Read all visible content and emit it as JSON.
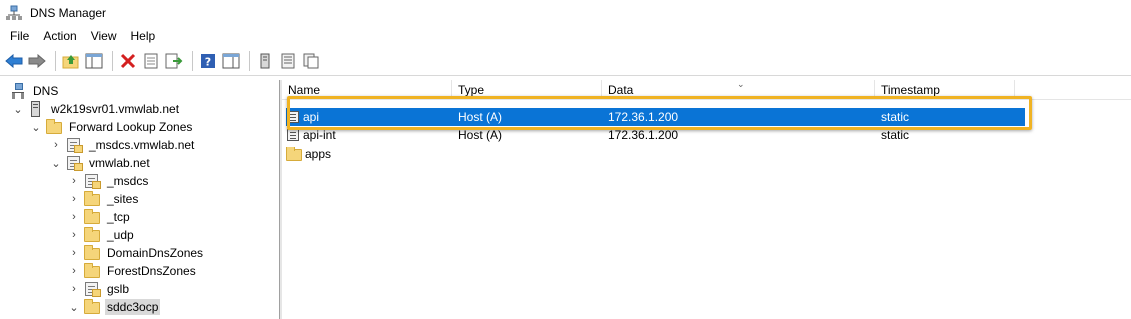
{
  "window": {
    "title": "DNS Manager",
    "icon": "dns-manager-icon"
  },
  "menu": [
    {
      "label": "File"
    },
    {
      "label": "Action"
    },
    {
      "label": "View"
    },
    {
      "label": "Help"
    }
  ],
  "toolbar": {
    "buttons": [
      "back-icon",
      "forward-icon",
      "up-folder-icon",
      "show-hide-console-tree-icon",
      "delete-icon",
      "properties-icon",
      "export-list-icon",
      "help-icon",
      "show-hide-action-pane-icon",
      "server-icon",
      "zone-list-icon",
      "copy-icon"
    ]
  },
  "tree": {
    "root": "DNS",
    "server": "w2k19svr01.vmwlab.net",
    "forward_zones": "Forward Lookup Zones",
    "zones": [
      "_msdcs.vmwlab.net",
      "vmwlab.net"
    ],
    "children": [
      "_msdcs",
      "_sites",
      "_tcp",
      "_udp",
      "DomainDnsZones",
      "ForestDnsZones",
      "gslb",
      "sddc3ocp"
    ],
    "selected": "sddc3ocp"
  },
  "list": {
    "columns": [
      "Name",
      "Type",
      "Data",
      "Timestamp"
    ],
    "rows": [
      {
        "name": "api",
        "type": "Host (A)",
        "data": "172.36.1.200",
        "timestamp": "static"
      },
      {
        "name": "api-int",
        "type": "Host (A)",
        "data": "172.36.1.200",
        "timestamp": "static"
      },
      {
        "name": "apps",
        "type": "",
        "data": "",
        "timestamp": ""
      }
    ],
    "selected_row": "api",
    "accent_color": "#0a74d6",
    "highlight_color": "#f0b323"
  }
}
